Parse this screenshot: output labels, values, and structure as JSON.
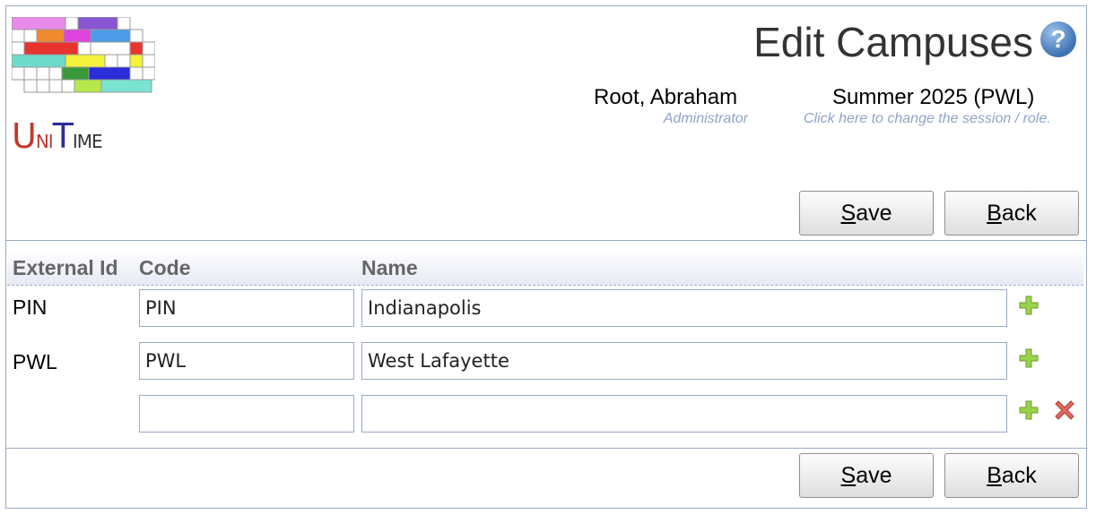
{
  "app": {
    "logo_text": "UniTime"
  },
  "header": {
    "title": "Edit Campuses",
    "help_icon": "help-icon",
    "user_name": "Root, Abraham",
    "user_role": "Administrator",
    "session": "Summer 2025 (PWL)",
    "session_hint": "Click here to change the session / role."
  },
  "buttons": {
    "save_prefix": "S",
    "save_rest": "ave",
    "back_prefix": "B",
    "back_rest": "ack"
  },
  "table": {
    "columns": [
      "External Id",
      "Code",
      "Name"
    ],
    "rows": [
      {
        "external_id": "PIN",
        "code": "PIN",
        "name": "Indianapolis"
      },
      {
        "external_id": "PWL",
        "code": "PWL",
        "name": "West Lafayette"
      },
      {
        "external_id": "",
        "code": "",
        "name": ""
      }
    ]
  },
  "colors": {
    "accent": "#9aaac4",
    "add": "#9bd14b",
    "delete": "#d9534f"
  }
}
